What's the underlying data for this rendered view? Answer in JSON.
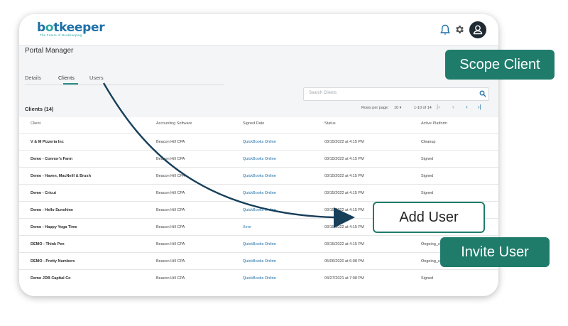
{
  "header": {
    "logo_text_pre": "b",
    "logo_text_o": "o",
    "logo_text_post": "tkeeper",
    "tagline": "The Future of Bookkeeping"
  },
  "page": {
    "title": "Portal Manager"
  },
  "tabs": [
    {
      "label": "Details"
    },
    {
      "label": "Clients"
    },
    {
      "label": "Users"
    }
  ],
  "search": {
    "placeholder": "Search Clients"
  },
  "clients": {
    "title": "Clients (14)",
    "rows_per_page_label": "Rows per page:",
    "rows_per_page_value": "10",
    "range": "1-10 of 14"
  },
  "table": {
    "columns": [
      "Client",
      "Accounting Software",
      "Signed Date",
      "Status",
      "Active Platform"
    ],
    "rows": [
      {
        "client": "V & M Pizzeria Inc",
        "software": "Beacon Hill CPA",
        "signed": "QuickBooks Online",
        "status": "03/15/2022 at 4:15 PM",
        "platform": "Cleanup"
      },
      {
        "client": "Demo - Connor's Farm",
        "software": "Beacon Hill CPA",
        "signed": "QuickBooks Online",
        "status": "03/15/2022 at 4:15 PM",
        "platform": "Signed"
      },
      {
        "client": "Demo - Haven, MacNeill & Brush",
        "software": "Beacon Hill CPA",
        "signed": "QuickBooks Online",
        "status": "03/15/2022 at 4:15 PM",
        "platform": "Signed"
      },
      {
        "client": "Demo - Cricut",
        "software": "Beacon Hill CPA",
        "signed": "QuickBooks Online",
        "status": "03/15/2022 at 4:15 PM",
        "platform": "Signed"
      },
      {
        "client": "Demo - Hello Sunshine",
        "software": "Beacon Hill CPA",
        "signed": "QuickBooks Online",
        "status": "03/15/2022 at 4:15 PM",
        "platform": ""
      },
      {
        "client": "Demo - Happy Yoga Time",
        "software": "Beacon Hill CPA",
        "signed": "Xero",
        "status": "03/15/2022 at 4:15 PM",
        "platform": ""
      },
      {
        "client": "DEMO - Think Pen",
        "software": "Beacon Hill CPA",
        "signed": "QuickBooks Online",
        "status": "03/15/2022 at 4:15 PM",
        "platform": "Ongoing_s"
      },
      {
        "client": "DEMO - Pretty Numbers",
        "software": "Beacon Hill CPA",
        "signed": "QuickBooks Online",
        "status": "05/06/2020 at 6:08 PM",
        "platform": "Ongoing_s"
      },
      {
        "client": "Demo JDB Capital Co",
        "software": "Beacon Hill CPA",
        "signed": "QuickBooks Online",
        "status": "04/27/2021 at 7:08 PM",
        "platform": "Signed"
      }
    ]
  },
  "callouts": {
    "scope_client": "Scope Client",
    "add_user": "Add User",
    "invite_user": "Invite User"
  },
  "colors": {
    "accent": "#1f7c6b",
    "link": "#1b6fa8",
    "logo_accent": "#2aa7a0"
  },
  "icons": [
    "bell-icon",
    "gear-icon",
    "user-avatar-icon",
    "search-icon",
    "chevron-left-icon",
    "chevron-right-icon",
    "last-page-icon",
    "dropdown-caret-icon"
  ]
}
